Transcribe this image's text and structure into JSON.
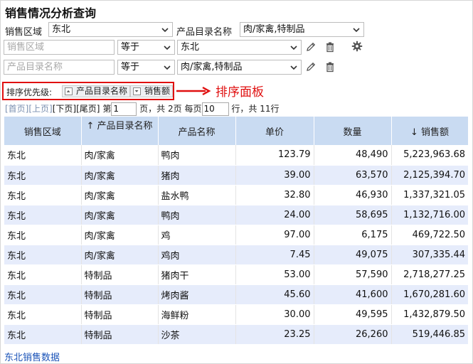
{
  "page": {
    "title": "销售情况分析查询"
  },
  "filters": {
    "region_label": "销售区域",
    "region_value": "东北",
    "product_catalog_label": "产品目录名称",
    "product_catalog_value": "肉/家禽,特制品"
  },
  "conditions": [
    {
      "field_placeholder": "销售区域",
      "operator": "等于",
      "value": "东北"
    },
    {
      "field_placeholder": "产品目录名称",
      "operator": "等于",
      "value": "肉/家禽,特制品"
    }
  ],
  "sort_panel": {
    "label": "排序优先级:",
    "chips": [
      "产品目录名称",
      "销售额"
    ],
    "annotation": "排序面板"
  },
  "pager": {
    "first": "[首页]",
    "prev": "[上页]",
    "next": "[下页]",
    "last": "[尾页]",
    "page_prefix": "第",
    "current_page": "1",
    "page_mid": "页，共",
    "total_pages": "2",
    "page_suffix": "页",
    "per_page_prefix": "每页",
    "per_page": "10",
    "per_page_suffix": "行，共",
    "total_rows": "11",
    "rows_suffix": "行"
  },
  "table": {
    "columns": [
      {
        "label": "销售区域",
        "sort": ""
      },
      {
        "label": "产品目录名称",
        "sort": "↑"
      },
      {
        "label": "产品名称",
        "sort": ""
      },
      {
        "label": "单价",
        "sort": ""
      },
      {
        "label": "数量",
        "sort": ""
      },
      {
        "label": "销售额",
        "sort": "↓"
      }
    ],
    "rows": [
      [
        "东北",
        "肉/家禽",
        "鸭肉",
        "123.79",
        "48,490",
        "5,223,963.68"
      ],
      [
        "东北",
        "肉/家禽",
        "猪肉",
        "39.00",
        "63,570",
        "2,125,394.70"
      ],
      [
        "东北",
        "肉/家禽",
        "盐水鸭",
        "32.80",
        "46,930",
        "1,337,321.05"
      ],
      [
        "东北",
        "肉/家禽",
        "鸭肉",
        "24.00",
        "58,695",
        "1,132,716.00"
      ],
      [
        "东北",
        "肉/家禽",
        "鸡",
        "97.00",
        "6,175",
        "469,722.50"
      ],
      [
        "东北",
        "肉/家禽",
        "鸡肉",
        "7.45",
        "49,075",
        "307,335.44"
      ],
      [
        "东北",
        "特制品",
        "猪肉干",
        "53.00",
        "57,590",
        "2,718,277.25"
      ],
      [
        "东北",
        "特制品",
        "烤肉酱",
        "45.60",
        "41,600",
        "1,670,281.60"
      ],
      [
        "东北",
        "特制品",
        "海鲜粉",
        "30.00",
        "49,595",
        "1,432,879.50"
      ],
      [
        "东北",
        "特制品",
        "沙茶",
        "23.25",
        "26,260",
        "519,446.85"
      ]
    ]
  },
  "footer": {
    "link": "东北销售数据"
  },
  "icons": {
    "edit": "pencil-icon",
    "delete": "trash-icon",
    "settings": "gear-icon",
    "dropdown": "chevron-down-icon",
    "arrow": "arrow-right-icon"
  },
  "colors": {
    "header_bg": "#c9dbf2",
    "row_alt_bg": "#e6ecfb",
    "highlight": "#e01010",
    "link": "#1a53b8"
  }
}
